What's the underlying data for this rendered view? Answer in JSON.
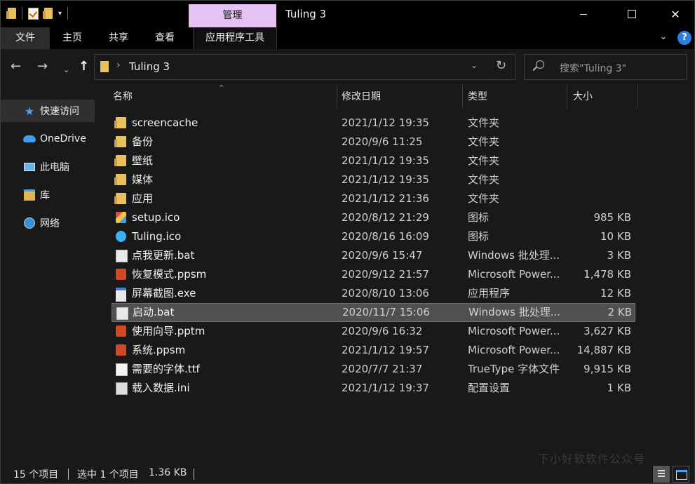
{
  "window": {
    "title": "Tuling 3",
    "manage_tab": "管理"
  },
  "ribbon": {
    "tabs": [
      "文件",
      "主页",
      "共享",
      "查看",
      "应用程序工具"
    ],
    "help": "?"
  },
  "address": {
    "path": "Tuling 3",
    "search_placeholder": "搜索\"Tuling 3\""
  },
  "sidebar": {
    "items": [
      {
        "label": "快速访问",
        "icon": "star-icon"
      },
      {
        "label": "OneDrive",
        "icon": "cloud-icon"
      },
      {
        "label": "此电脑",
        "icon": "computer-icon"
      },
      {
        "label": "库",
        "icon": "library-icon"
      },
      {
        "label": "网络",
        "icon": "network-icon"
      }
    ]
  },
  "columns": {
    "name": "名称",
    "date": "修改日期",
    "type": "类型",
    "size": "大小"
  },
  "files": [
    {
      "name": "screencache",
      "date": "2021/1/12 19:35",
      "type": "文件夹",
      "size": "",
      "icon": "folder"
    },
    {
      "name": "备份",
      "date": "2020/9/6 11:25",
      "type": "文件夹",
      "size": "",
      "icon": "folder"
    },
    {
      "name": "壁纸",
      "date": "2021/1/12 19:35",
      "type": "文件夹",
      "size": "",
      "icon": "folder"
    },
    {
      "name": "媒体",
      "date": "2021/1/12 19:35",
      "type": "文件夹",
      "size": "",
      "icon": "folder"
    },
    {
      "name": "应用",
      "date": "2021/1/12 21:36",
      "type": "文件夹",
      "size": "",
      "icon": "folder"
    },
    {
      "name": "setup.ico",
      "date": "2020/8/12 21:29",
      "type": "图标",
      "size": "985 KB",
      "icon": "ico1"
    },
    {
      "name": "Tuling.ico",
      "date": "2020/8/16 16:09",
      "type": "图标",
      "size": "10 KB",
      "icon": "ico2"
    },
    {
      "name": "点我更新.bat",
      "date": "2020/9/6 15:47",
      "type": "Windows 批处理...",
      "size": "3 KB",
      "icon": "bat"
    },
    {
      "name": "恢复模式.ppsm",
      "date": "2020/9/12 21:57",
      "type": "Microsoft Power...",
      "size": "1,478 KB",
      "icon": "ppt"
    },
    {
      "name": "屏幕截图.exe",
      "date": "2020/8/10 13:06",
      "type": "应用程序",
      "size": "12 KB",
      "icon": "exe"
    },
    {
      "name": "启动.bat",
      "date": "2020/11/7 15:06",
      "type": "Windows 批处理...",
      "size": "2 KB",
      "icon": "bat",
      "selected": true
    },
    {
      "name": "使用向导.pptm",
      "date": "2020/9/6 16:32",
      "type": "Microsoft Power...",
      "size": "3,627 KB",
      "icon": "ppt"
    },
    {
      "name": "系统.ppsm",
      "date": "2021/1/12 19:57",
      "type": "Microsoft Power...",
      "size": "14,887 KB",
      "icon": "ppt"
    },
    {
      "name": "需要的字体.ttf",
      "date": "2020/7/7 21:37",
      "type": "TrueType 字体文件",
      "size": "9,915 KB",
      "icon": "ttf"
    },
    {
      "name": "载入数据.ini",
      "date": "2021/1/12 19:37",
      "type": "配置设置",
      "size": "1 KB",
      "icon": "ini"
    }
  ],
  "status": {
    "count": "15 个项目",
    "selected": "选中 1 个项目",
    "selected_size": "1.36 KB"
  },
  "watermark": "下小好软软件公众号"
}
